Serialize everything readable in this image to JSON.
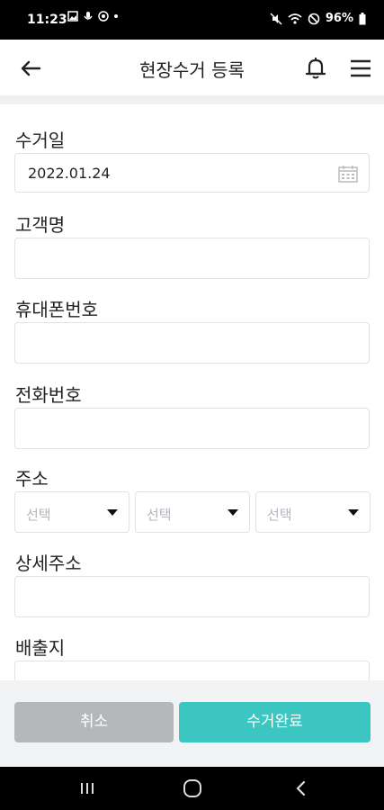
{
  "status": {
    "time": "11:23",
    "battery": "96%"
  },
  "header": {
    "title": "현장수거 등록"
  },
  "form": {
    "date_label": "수거일",
    "date_value": "2022.01.24",
    "name_label": "고객명",
    "mobile_label": "휴대폰번호",
    "phone_label": "전화번호",
    "address_label": "주소",
    "address_selects": [
      "선택",
      "선택",
      "선택"
    ],
    "detail_label": "상세주소",
    "origin_label": "배출지"
  },
  "actions": {
    "cancel": "취소",
    "complete": "수거완료"
  },
  "colors": {
    "primary": "#3cc6c1",
    "cancel": "#b5b7ba"
  }
}
